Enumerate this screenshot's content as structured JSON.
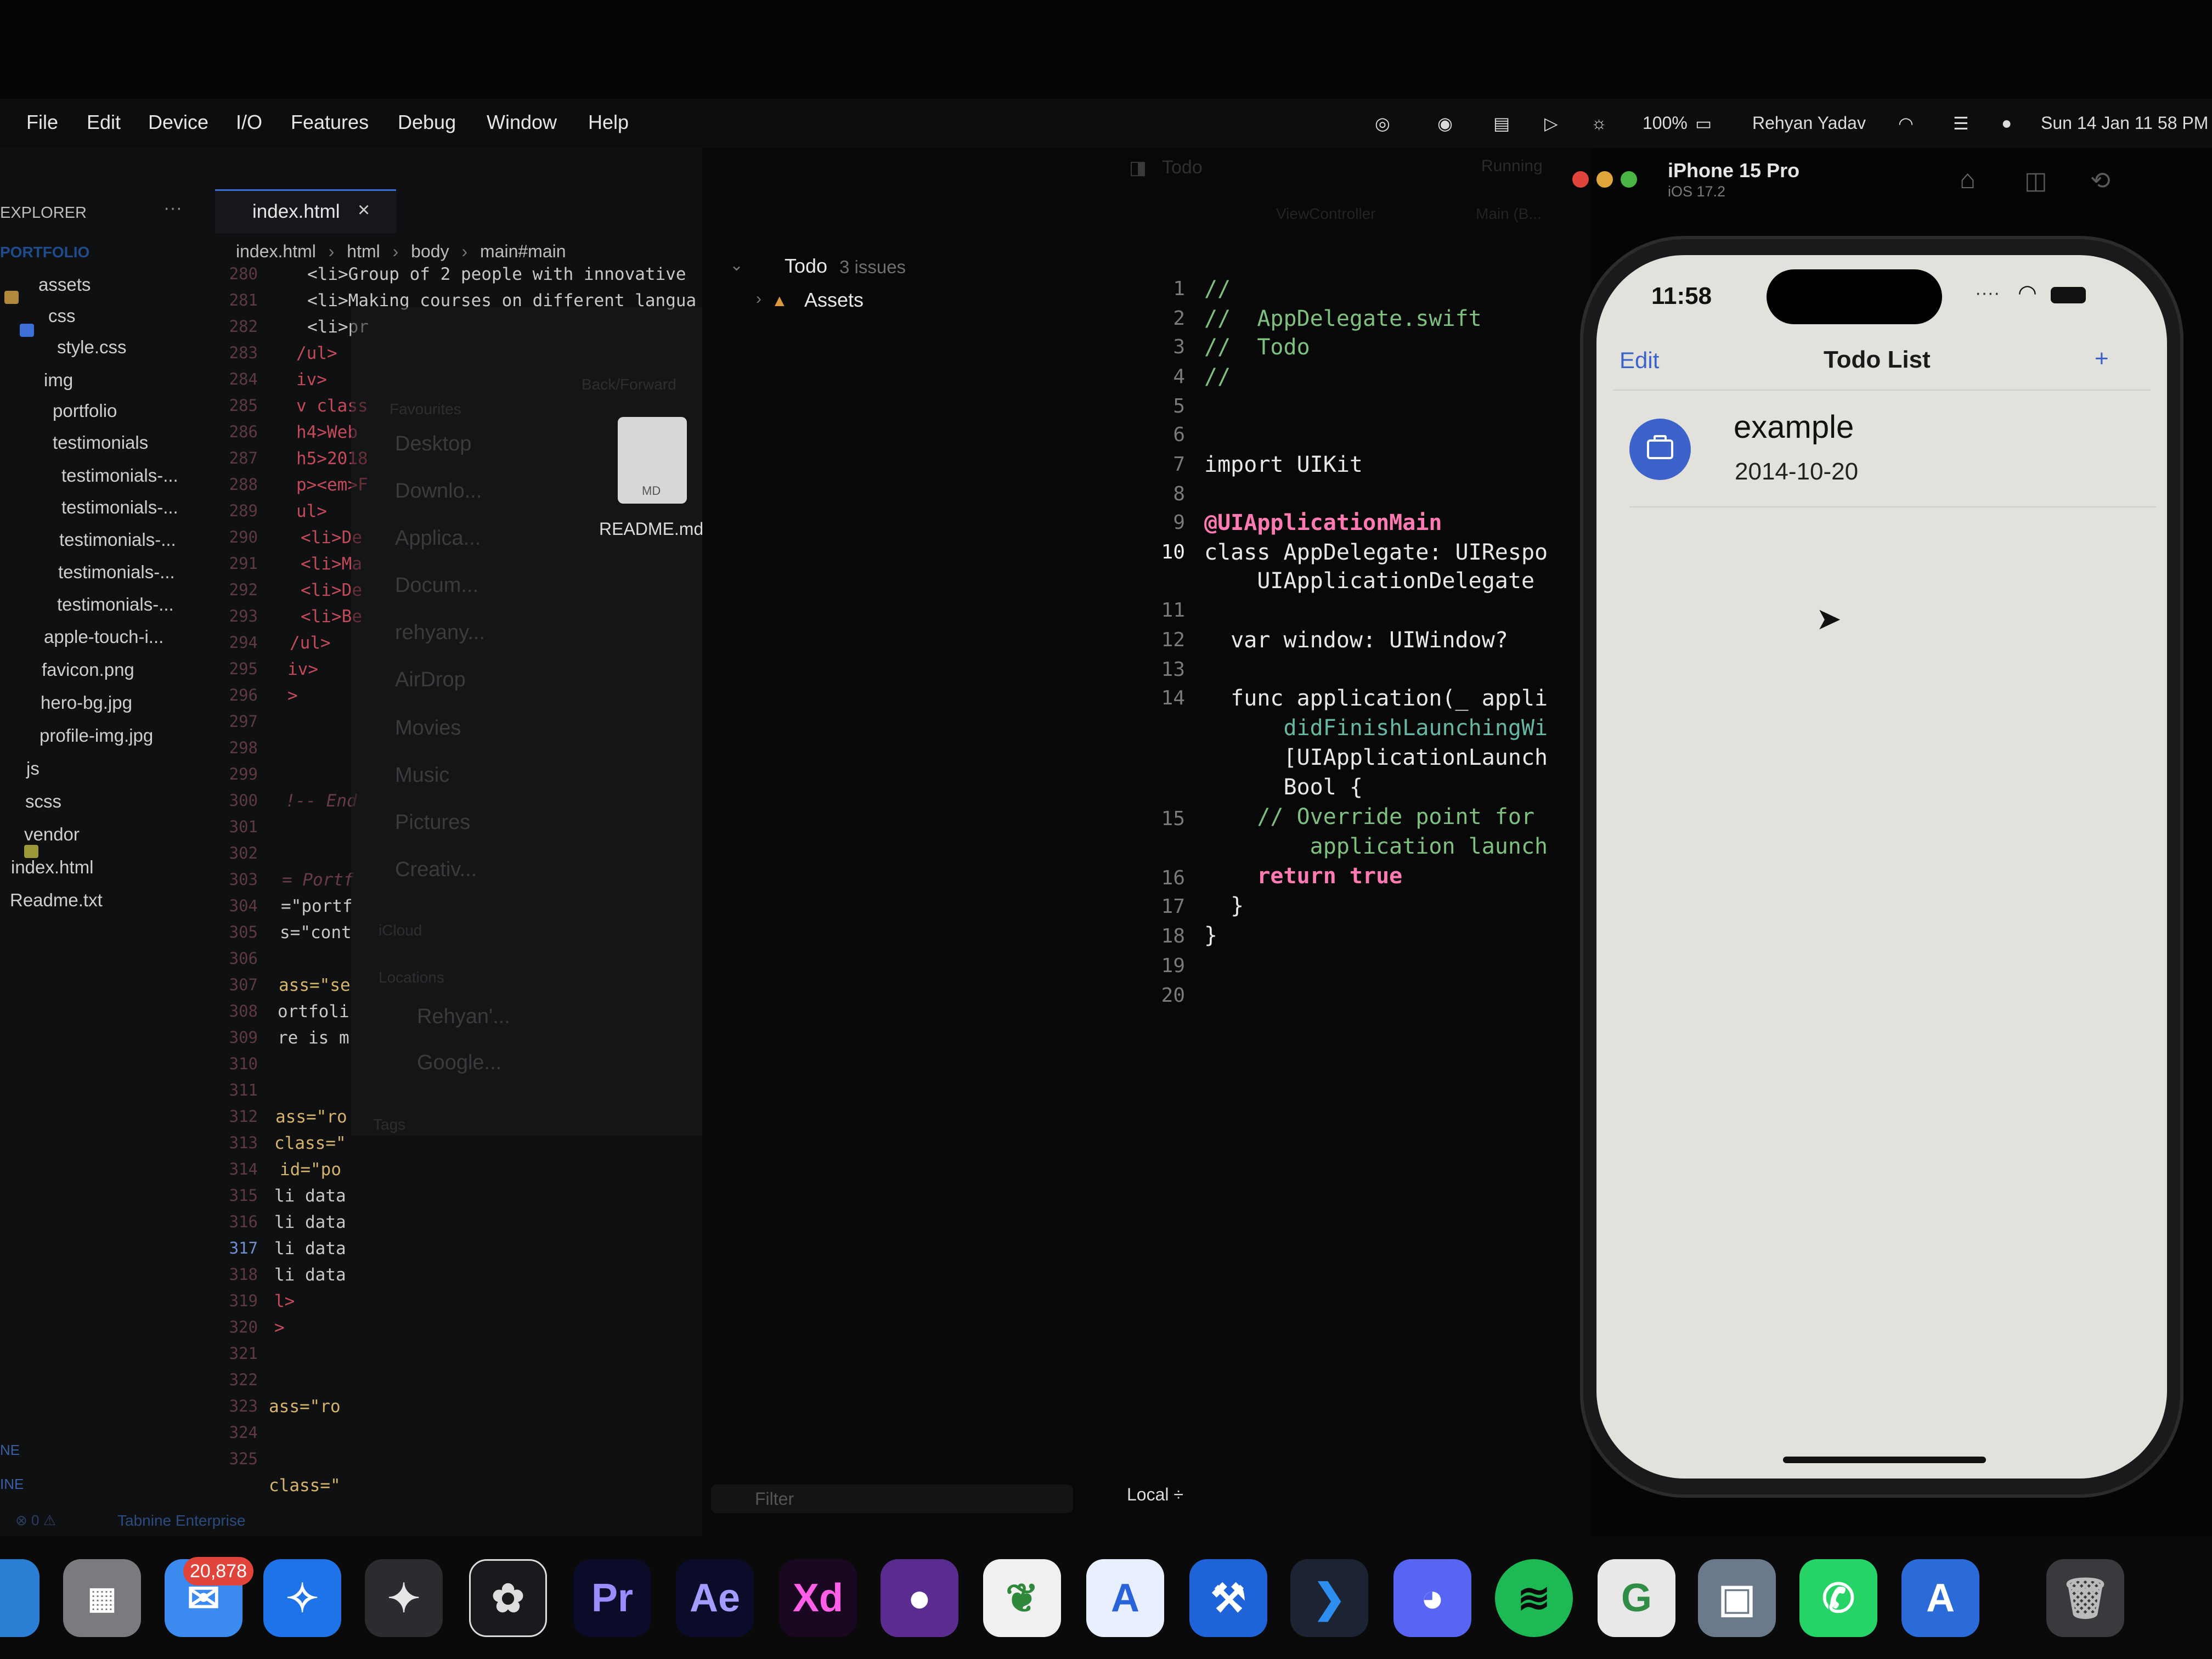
{
  "menubar": {
    "items": [
      "File",
      "Edit",
      "Device",
      "I/O",
      "Features",
      "Debug",
      "Window",
      "Help"
    ],
    "battery": "100%",
    "user": "Rehyan Yadav",
    "datetime": "Sun 14 Jan  11 58 PM"
  },
  "vscode": {
    "explorer_title": "EXPLORER",
    "more_glyph": "···",
    "tab_label": "index.html",
    "tab_close": "×",
    "breadcrumb": [
      "index.html",
      "html",
      "body",
      "main#main"
    ],
    "project": "PORTFOLIO",
    "tree": [
      "assets",
      "css",
      "style.css",
      "img",
      "portfolio",
      "testimonials",
      "testimonials-...",
      "testimonials-...",
      "testimonials-...",
      "testimonials-...",
      "testimonials-...",
      "apple-touch-i...",
      "favicon.png",
      "hero-bg.jpg",
      "profile-img.jpg",
      "js",
      "scss",
      "vendor",
      "index.html",
      "Readme.txt"
    ],
    "line_numbers": [
      "280",
      "281",
      "282",
      "283",
      "284",
      "285",
      "286",
      "287",
      "288",
      "289",
      "290",
      "291",
      "292",
      "293",
      "294",
      "295",
      "296",
      "297",
      "298",
      "299",
      "300",
      "301",
      "302",
      "303",
      "304",
      "305",
      "306",
      "307",
      "308",
      "309",
      "310",
      "311",
      "312",
      "313",
      "314",
      "315",
      "316",
      "317",
      "318",
      "319",
      "320",
      "321",
      "322",
      "323",
      "324",
      "325"
    ],
    "code_lines": [
      "<li>Group of 2 people with innovative",
      "<li>Making courses on different langua",
      "<li>pr",
      "/ul>",
      "iv>",
      "v class",
      "h4>Web",
      "h5>2018",
      "p><em>F",
      "ul>",
      "<li>De",
      "<li>Ma",
      "<li>De",
      "<li>Be",
      "/ul>",
      "iv>",
      ">",
      "",
      "",
      "",
      "!-- End",
      "",
      "",
      "= Portf",
      "=\"portf",
      "s=\"cont",
      "",
      "ass=\"se",
      "ortfoli",
      "re is m",
      "",
      "",
      "ass=\"ro",
      "class=\"",
      "id=\"po",
      "li data",
      "li data",
      "li data",
      "li data",
      "l>",
      ">",
      "",
      "",
      "ass=\"ro",
      "",
      "class=\""
    ],
    "outline_labels": [
      "NE",
      "INE"
    ],
    "status_left": "⊗ 0  ⚠",
    "status_tabnine": "Tabnine Enterprise"
  },
  "finder": {
    "back_forward": "Back/Forward",
    "favourites_header": "Favourites",
    "items": [
      "Desktop",
      "Downlo...",
      "Applica...",
      "Docum...",
      "rehyany...",
      "AirDrop",
      "Movies",
      "Music",
      "Pictures",
      "Creativ..."
    ],
    "icloud": "iCloud",
    "locations": "Locations",
    "location_items": [
      "Rehyan'...",
      "Google..."
    ],
    "tags": "Tags",
    "file_name": "README.md",
    "file_badge": "MD"
  },
  "xcode": {
    "scheme": "Todo",
    "running": "Running",
    "tab_viewcontroller": "ViewController",
    "tab_main": "Main (B...",
    "navigator_project": "Todo",
    "navigator_issues": "3 issues",
    "navigator_assets": "Assets",
    "filter_placeholder": "Filter",
    "local_label": "Local ÷",
    "line_numbers": [
      "1",
      "2",
      "3",
      "4",
      "5",
      "6",
      "7",
      "8",
      "9",
      "10",
      "11",
      "12",
      "13",
      "14",
      "",
      "",
      "15",
      "",
      "16",
      "17",
      "18",
      "19",
      "20"
    ],
    "code": [
      "//",
      "//  AppDelegate.swift",
      "//  Todo",
      "//",
      "",
      "",
      "import UIKit",
      "",
      "@UIApplicationMain",
      "class AppDelegate: UIRespo",
      "    UIApplicationDelegate",
      "",
      "  var window: UIWindow?",
      "",
      "  func application(_ appli",
      "      didFinishLaunchingWi",
      "      [UIApplicationLaunch",
      "      Bool {",
      "    // Override point for",
      "        application launch",
      "    return true",
      "  }",
      "}",
      "",
      ""
    ]
  },
  "simulator": {
    "device_name": "iPhone 15 Pro",
    "os_version": "iOS 17.2",
    "time": "11:58",
    "nav_edit": "Edit",
    "nav_title": "Todo List",
    "nav_add": "+",
    "item_title": "example",
    "item_date": "2014-10-20",
    "accent_color": "#3b63c9"
  },
  "dock": {
    "mail_badge": "20,878",
    "apps": [
      "finder-icon",
      "launchpad-icon",
      "mail-icon",
      "safari-icon",
      "final-cut-icon",
      "davinci-resolve-icon",
      "premiere-pro-icon",
      "after-effects-icon",
      "adobe-xd-icon",
      "github-icon",
      "mongodb-compass-icon",
      "app-store-icon",
      "xcode-icon",
      "vscode-icon",
      "discord-icon",
      "spotify-icon",
      "geeksforgeeks-icon",
      "preview-icon",
      "whatsapp-icon",
      "simulator-icon",
      "trash-icon"
    ],
    "premiere_label": "Pr",
    "aftereffects_label": "Ae",
    "xd_label": "Xd"
  }
}
